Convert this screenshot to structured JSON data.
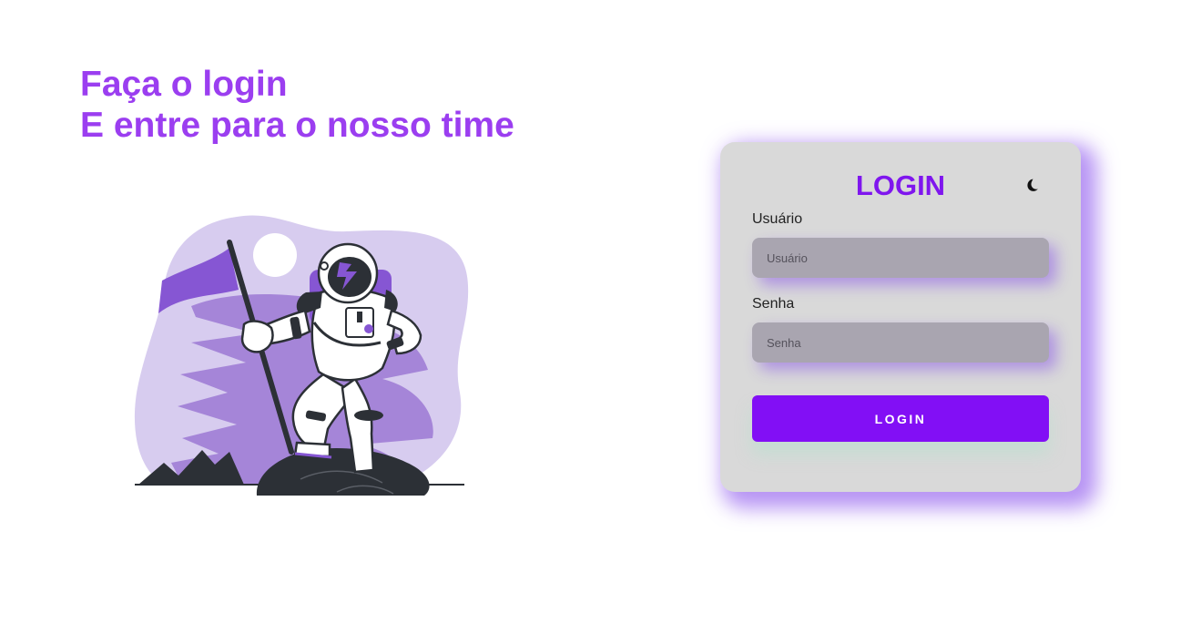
{
  "hero": {
    "line1": "Faça o login",
    "line2": "E entre para o nosso time"
  },
  "illustration": {
    "name": "astronaut-with-flag",
    "colors": {
      "purple": "#8656d3",
      "light_purple": "#d7ccef",
      "mid_purple": "#a585d8",
      "dark": "#2c3036"
    }
  },
  "login": {
    "title": "LOGIN",
    "theme_icon": "moon-icon",
    "username": {
      "label": "Usuário",
      "placeholder": "Usuário"
    },
    "password": {
      "label": "Senha",
      "placeholder": "Senha"
    },
    "submit_label": "LOGIN"
  },
  "colors": {
    "accent": "#9b3ef0",
    "button": "#820ff5",
    "card_bg": "#d9d9d9",
    "input_bg": "#a9a5b0"
  }
}
